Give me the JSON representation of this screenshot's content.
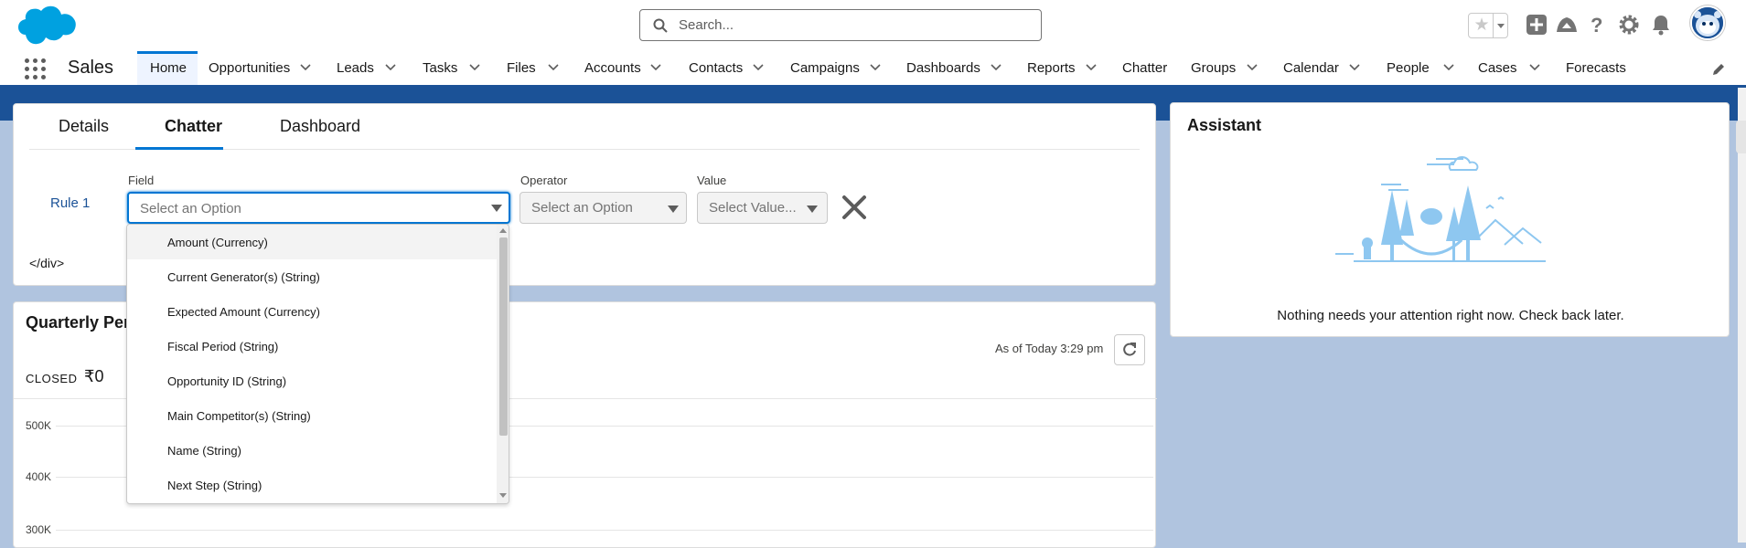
{
  "header": {
    "search_placeholder": "Search..."
  },
  "nav": {
    "app_name": "Sales",
    "items": [
      {
        "label": "Home"
      },
      {
        "label": "Opportunities"
      },
      {
        "label": "Leads"
      },
      {
        "label": "Tasks"
      },
      {
        "label": "Files"
      },
      {
        "label": "Accounts"
      },
      {
        "label": "Contacts"
      },
      {
        "label": "Campaigns"
      },
      {
        "label": "Dashboards"
      },
      {
        "label": "Reports"
      },
      {
        "label": "Chatter"
      },
      {
        "label": "Groups"
      },
      {
        "label": "Calendar"
      },
      {
        "label": "People"
      },
      {
        "label": "Cases"
      },
      {
        "label": "Forecasts"
      }
    ]
  },
  "main": {
    "tabs": [
      {
        "label": "Details"
      },
      {
        "label": "Chatter"
      },
      {
        "label": "Dashboard"
      }
    ],
    "active_tab": "Chatter",
    "rule_label": "Rule 1",
    "field_label": "Field",
    "field_value": "Select an Option",
    "operator_label": "Operator",
    "operator_value": "Select an Option",
    "value_label": "Value",
    "value_value": "Select Value...",
    "trailing_text": "</div>"
  },
  "field_dropdown": {
    "options": [
      "Amount (Currency)",
      "Current Generator(s) (String)",
      "Expected Amount (Currency)",
      "Fiscal Period (String)",
      "Opportunity ID (String)",
      "Main Competitor(s) (String)",
      "Name (String)",
      "Next Step (String)"
    ],
    "highlighted_index": 0
  },
  "quarterly": {
    "title": "Quarterly Per",
    "as_of": "As of Today 3:29 pm",
    "closed_label": "CLOSED",
    "closed_value": "₹0",
    "ticks": [
      "500K",
      "400K",
      "300K"
    ]
  },
  "assistant": {
    "title": "Assistant",
    "message": "Nothing needs your attention right now. Check back later."
  },
  "colors": {
    "brand": "#0176d3",
    "banner": "#1b5297",
    "logo": "#00a1e0"
  },
  "icons": [
    "salesforce-cloud-icon",
    "search-icon",
    "star-icon",
    "plus-icon",
    "trailhead-icon",
    "help-icon",
    "gear-icon",
    "bell-icon",
    "waffle-icon",
    "chevron-down-icon",
    "pencil-icon",
    "close-icon",
    "refresh-icon"
  ]
}
